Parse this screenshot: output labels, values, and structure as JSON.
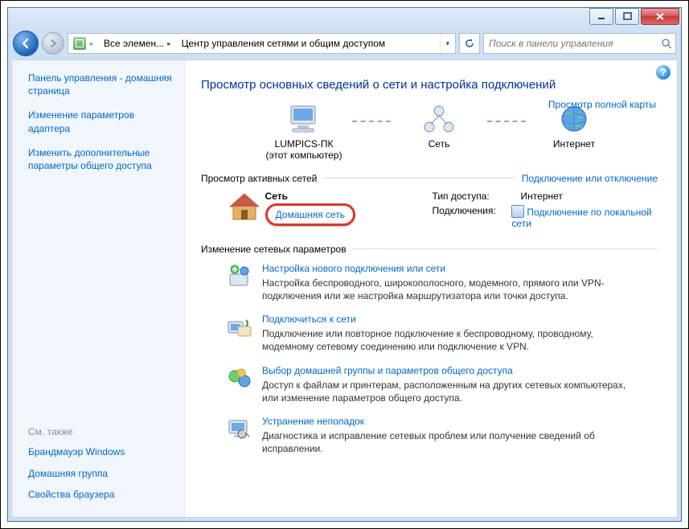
{
  "window": {
    "breadcrumb_root": "Все элемен...",
    "breadcrumb_current": "Центр управления сетями и общим доступом",
    "search_placeholder": "Поиск в панели управления"
  },
  "sidebar": {
    "links": [
      "Панель управления - домашняя страница",
      "Изменение параметров адаптера",
      "Изменить дополнительные параметры общего доступа"
    ],
    "see_also_hdr": "См. также",
    "see_also": [
      "Брандмауэр Windows",
      "Домашняя группа",
      "Свойства браузера"
    ]
  },
  "main": {
    "title": "Просмотр основных сведений о сети и настройка подключений",
    "full_map": "Просмотр полной карты",
    "nodes": {
      "pc": {
        "name": "LUMPICS-ПК",
        "note": "(этот компьютер)"
      },
      "net": "Сеть",
      "inet": "Интернет"
    },
    "active_hdr": "Просмотр активных сетей",
    "active_link": "Подключение или отключение",
    "network": {
      "name": "Сеть",
      "type": "Домашняя сеть",
      "access_k": "Тип доступа:",
      "access_v": "Интернет",
      "conn_k": "Подключения:",
      "conn_v": "Подключение по локальной сети"
    },
    "change_hdr": "Изменение сетевых параметров",
    "options": [
      {
        "t": "Настройка нового подключения или сети",
        "d": "Настройка беспроводного, широкополосного, модемного, прямого или VPN-подключения или же настройка маршрутизатора или точки доступа."
      },
      {
        "t": "Подключиться к сети",
        "d": "Подключение или повторное подключение к беспроводному, проводному, модемному сетевому соединению или подключение к VPN."
      },
      {
        "t": "Выбор домашней группы и параметров общего доступа",
        "d": "Доступ к файлам и принтерам, расположенным на других сетевых компьютерах, или изменение параметров общего доступа."
      },
      {
        "t": "Устранение неполадок",
        "d": "Диагностика и исправление сетевых проблем или получение сведений об исправлении."
      }
    ]
  }
}
